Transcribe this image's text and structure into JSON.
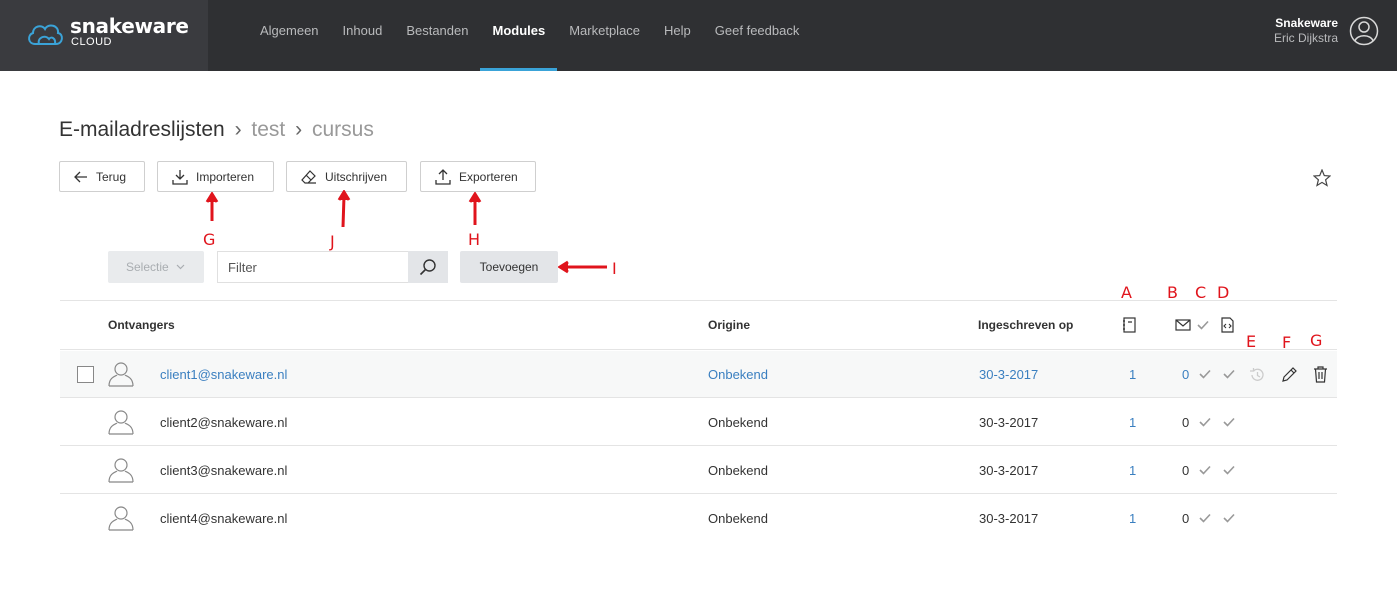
{
  "brand": {
    "name": "snakeware",
    "sub": "CLOUD"
  },
  "nav": [
    {
      "label": "Algemeen",
      "active": false
    },
    {
      "label": "Inhoud",
      "active": false
    },
    {
      "label": "Bestanden",
      "active": false
    },
    {
      "label": "Modules",
      "active": true
    },
    {
      "label": "Marketplace",
      "active": false
    },
    {
      "label": "Help",
      "active": false
    },
    {
      "label": "Geef feedback",
      "active": false
    }
  ],
  "user": {
    "company": "Snakeware",
    "name": "Eric Dijkstra"
  },
  "breadcrumb": {
    "root": "E-mailadreslijsten",
    "sep": "›",
    "level1": "test",
    "level2": "cursus"
  },
  "toolbar": {
    "back": "Terug",
    "import": "Importeren",
    "unsubscribe": "Uitschrijven",
    "export": "Exporteren"
  },
  "filter": {
    "select_label": "Selectie",
    "placeholder": "Filter",
    "add_label": "Toevoegen"
  },
  "annotations": {
    "A": "A",
    "B": "B",
    "C": "C",
    "D": "D",
    "E": "E",
    "F": "F",
    "G_row": "G",
    "G": "G",
    "J": "J",
    "H": "H",
    "I": "I"
  },
  "table": {
    "headers": {
      "recipients": "Ontvangers",
      "origin": "Origine",
      "subscribed": "Ingeschreven op"
    },
    "rows": [
      {
        "email": "client1@snakeware.nl",
        "origin": "Onbekend",
        "date": "30-3-2017",
        "lists": "1",
        "mails": "0"
      },
      {
        "email": "client2@snakeware.nl",
        "origin": "Onbekend",
        "date": "30-3-2017",
        "lists": "1",
        "mails": "0"
      },
      {
        "email": "client3@snakeware.nl",
        "origin": "Onbekend",
        "date": "30-3-2017",
        "lists": "1",
        "mails": "0"
      },
      {
        "email": "client4@snakeware.nl",
        "origin": "Onbekend",
        "date": "30-3-2017",
        "lists": "1",
        "mails": "0"
      }
    ]
  },
  "colors": {
    "accent": "#3aa3d8",
    "link": "#3a7fc0",
    "annotation": "#e0141c",
    "topbar": "#2f3033"
  }
}
